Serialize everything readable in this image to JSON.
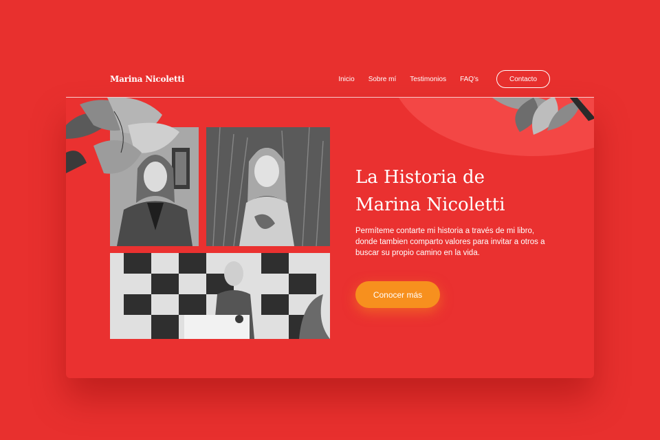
{
  "nav": {
    "brand": "Marina Nicoletti",
    "links": [
      {
        "label": "Inicio"
      },
      {
        "label": "Sobre mí"
      },
      {
        "label": "Testimonios"
      },
      {
        "label": "FAQ's"
      }
    ],
    "contact_label": "Contacto"
  },
  "hero": {
    "title_line1": "La Historia de",
    "title_line2": "Marina Nicoletti",
    "description": "Permíteme contarte mi historia a través de mi libro, donde tambien comparto valores para invitar a otros a buscar su propio camino en la vida.",
    "cta_label": "Conocer más"
  },
  "colors": {
    "background": "#e8302e",
    "accent_circle": "#f34745",
    "cta": "#f7901e",
    "text": "#ffffff"
  },
  "icons": [
    "lotus-flower-left",
    "lotus-flower-right"
  ]
}
